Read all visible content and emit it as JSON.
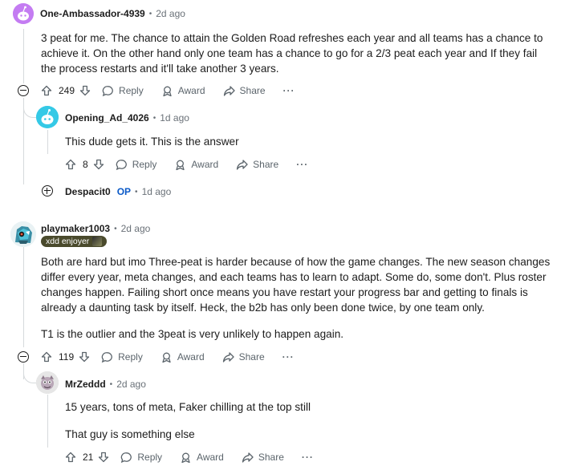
{
  "comments": [
    {
      "author": "One-Ambassador-4939",
      "time": "2d ago",
      "body": "3 peat for me. The chance to attain the Golden Road refreshes each year and all teams has a chance to achieve it. On the other hand only one team has a chance to go for a 2/3 peat each year and If they fail the process restarts and it'll take another 3 years.",
      "votes": "249",
      "reply": "Reply",
      "award": "Award",
      "share": "Share",
      "more": "···",
      "avatar_color": "#c47cf2"
    },
    {
      "author": "Opening_Ad_4026",
      "time": "1d ago",
      "body": "This dude gets it. This is the answer",
      "votes": "8",
      "reply": "Reply",
      "award": "Award",
      "share": "Share",
      "more": "···",
      "avatar_color": "#35c9e6"
    },
    {
      "author": "Despacit0",
      "op": "OP",
      "time": "1d ago"
    },
    {
      "author": "playmaker1003",
      "time": "2d ago",
      "flair": "xdd enjoyer",
      "body_p1": "Both are hard but imo Three-peat is harder because of how the game changes. The new season changes differ every year, meta changes, and each teams has to learn to adapt. Some do, some don't. Plus roster changes happen. Failing short once means you have restart your progress bar and getting to finals is already a daunting task by itself. Heck, the b2b has only been done twice, by one team only.",
      "body_p2": "T1 is the outlier and the 3peat is very unlikely to happen again.",
      "votes": "119",
      "reply": "Reply",
      "award": "Award",
      "share": "Share",
      "more": "···"
    },
    {
      "author": "MrZeddd",
      "time": "2d ago",
      "body_p1": "15 years, tons of meta, Faker chilling at the top still",
      "body_p2": "That guy is something else",
      "votes": "21",
      "reply": "Reply",
      "award": "Award",
      "share": "Share",
      "more": "···"
    }
  ],
  "colors": {
    "text": "#1c1c1c",
    "meta": "#6a7178",
    "op": "#0a59c7",
    "thread_line": "#d6dadc",
    "flair_bg": "#4a4a2c"
  }
}
